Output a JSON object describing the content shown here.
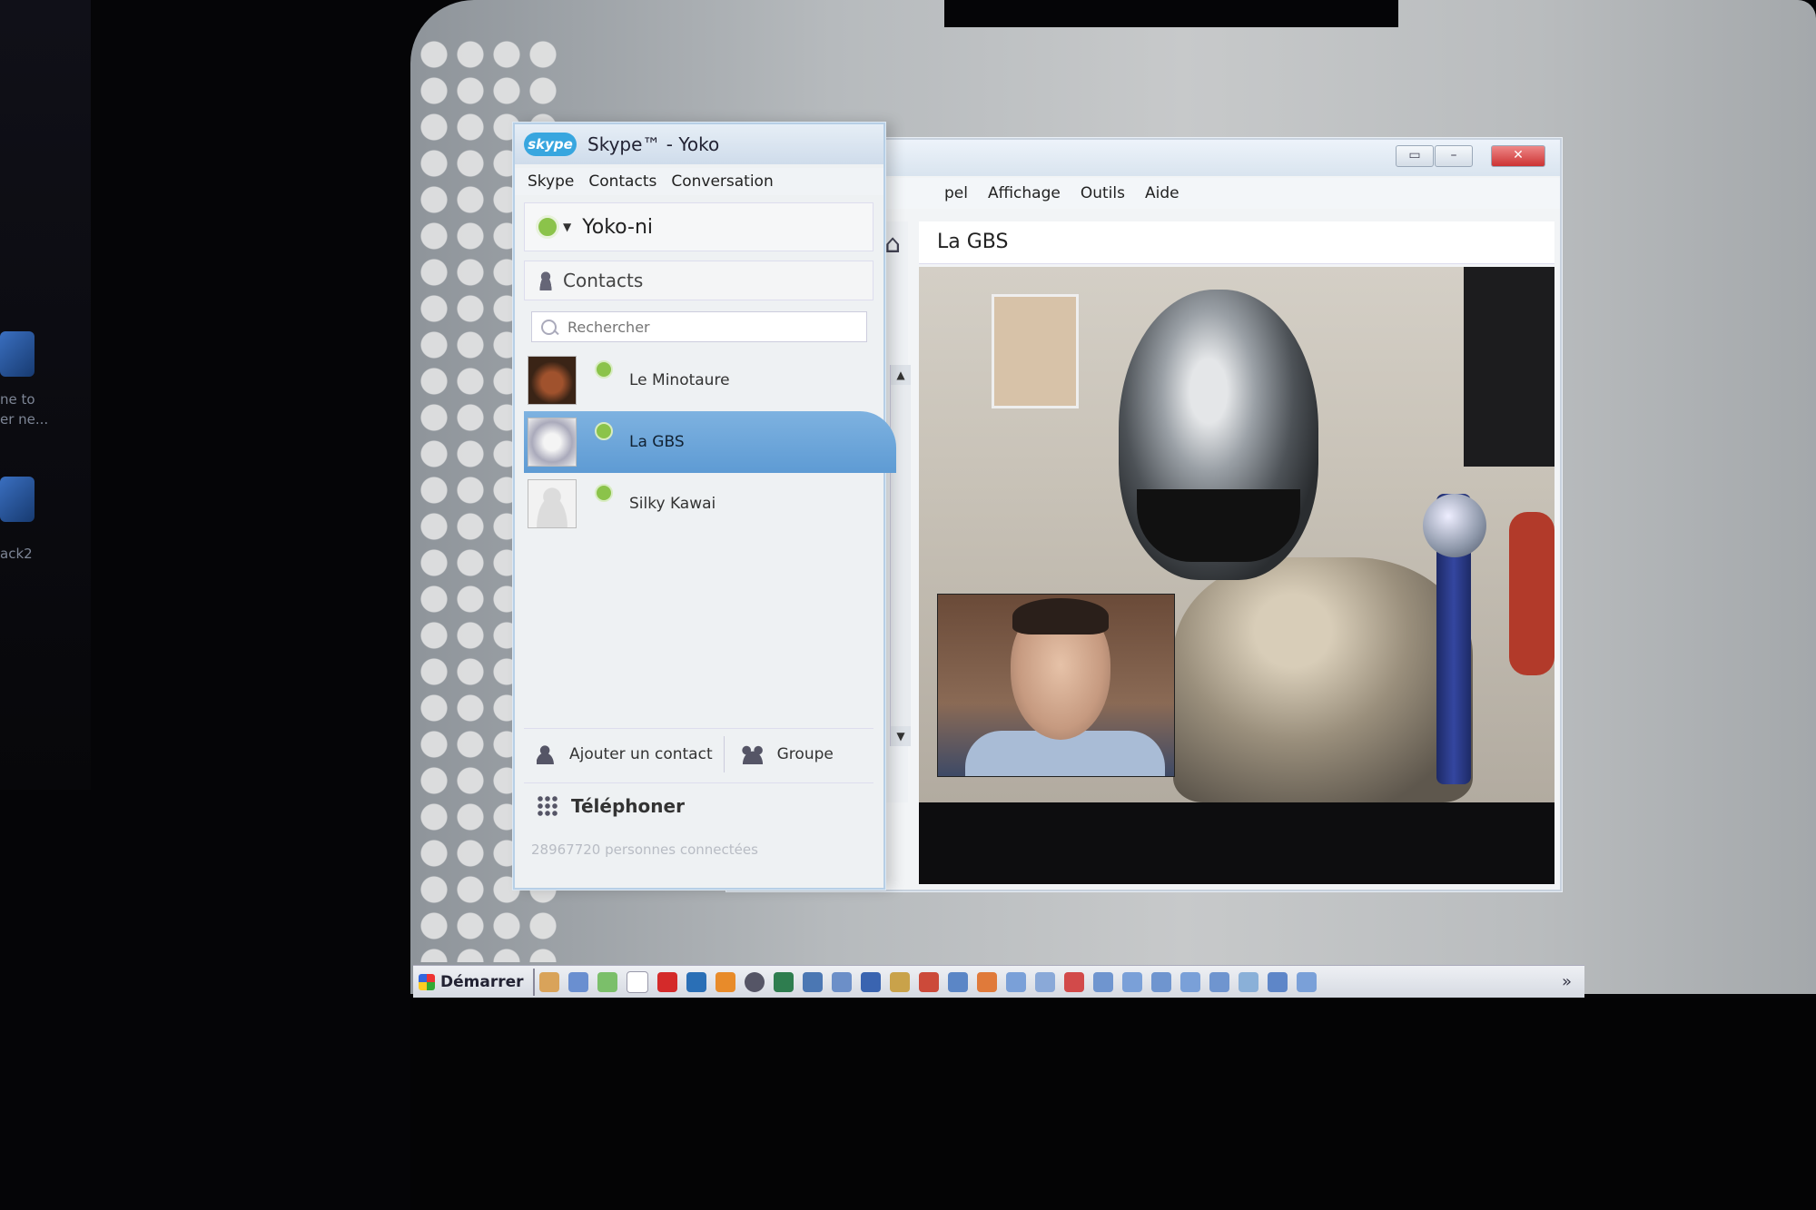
{
  "desktop": {
    "icon_labels": [
      "ne to",
      "er ne...",
      "ack2"
    ]
  },
  "taskbar": {
    "start_label": "Démarrer",
    "overflow_label": "»"
  },
  "chat_window": {
    "window_buttons": {
      "restore": "▭",
      "minimize": "–",
      "maximize": "□",
      "close": "✕"
    },
    "menu": [
      "pel",
      "Affichage",
      "Outils",
      "Aide"
    ],
    "conversation_title": "La GBS"
  },
  "skype": {
    "logo_text": "skype",
    "title": "Skype™ - Yoko",
    "menu": [
      "Skype",
      "Contacts",
      "Conversation"
    ],
    "profile_name": "Yoko-ni",
    "contacts_tab": "Contacts",
    "search_placeholder": "Rechercher",
    "contacts": [
      {
        "name": "Le Minotaure"
      },
      {
        "name": "La GBS"
      },
      {
        "name": "Silky Kawai"
      }
    ],
    "add_contact_label": "Ajouter un contact",
    "group_label": "Groupe",
    "call_label": "Téléphoner",
    "online_count": "28967720 personnes connectées"
  },
  "colors": {
    "selected_contact": "#5e9bd4",
    "online_status": "#8bc34a",
    "skype_blue": "#38a6df"
  }
}
